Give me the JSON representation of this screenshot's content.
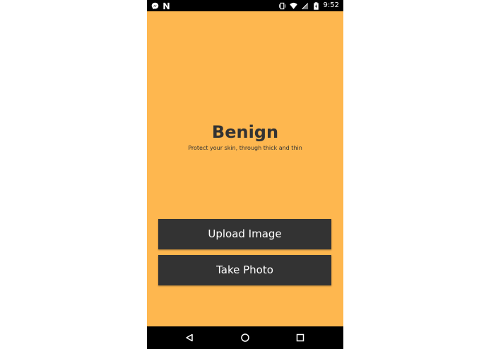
{
  "status_bar": {
    "time": "9:52",
    "left_icons": [
      "messenger-icon",
      "n-notification-icon"
    ],
    "right_icons": [
      "vibrate-icon",
      "wifi-icon",
      "cell-signal-icon",
      "battery-charging-icon"
    ]
  },
  "hero": {
    "title": "Benign",
    "tagline": "Protect your skin, through thick and thin"
  },
  "actions": {
    "upload_label": "Upload Image",
    "photo_label": "Take Photo"
  },
  "nav_bar": {
    "buttons": [
      "back-icon",
      "home-icon",
      "recents-icon"
    ]
  },
  "colors": {
    "background": "#feb74f",
    "button": "#333333",
    "button_text": "#ffffff",
    "text": "#333333",
    "system_bars": "#000000"
  }
}
